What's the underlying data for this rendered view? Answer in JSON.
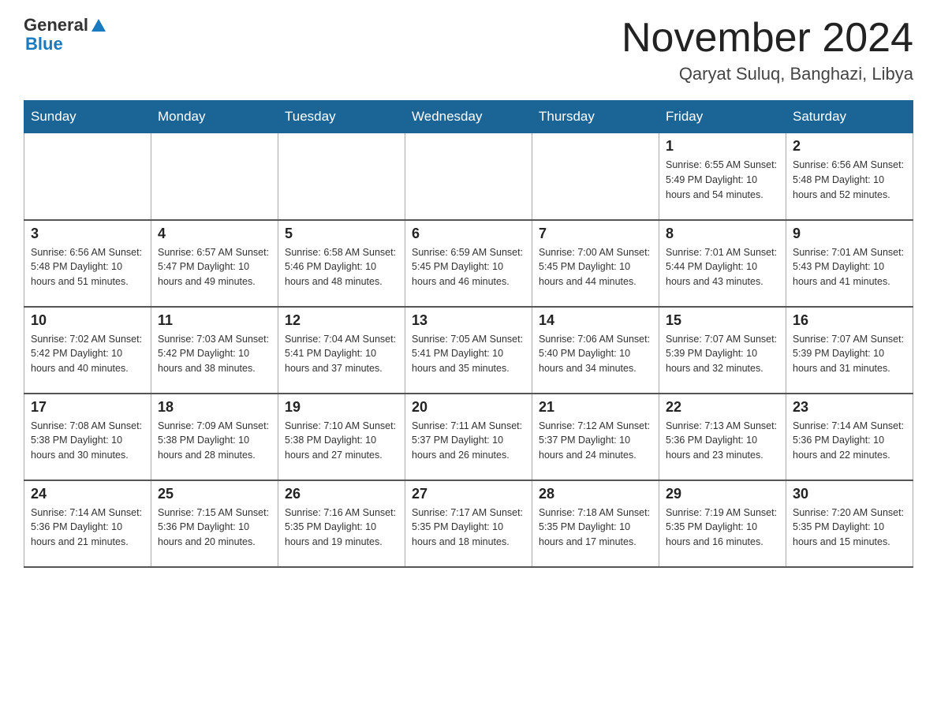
{
  "header": {
    "logo_general": "General",
    "logo_blue": "Blue",
    "month_title": "November 2024",
    "location": "Qaryat Suluq, Banghazi, Libya"
  },
  "days_of_week": [
    "Sunday",
    "Monday",
    "Tuesday",
    "Wednesday",
    "Thursday",
    "Friday",
    "Saturday"
  ],
  "weeks": [
    [
      {
        "day": "",
        "info": ""
      },
      {
        "day": "",
        "info": ""
      },
      {
        "day": "",
        "info": ""
      },
      {
        "day": "",
        "info": ""
      },
      {
        "day": "",
        "info": ""
      },
      {
        "day": "1",
        "info": "Sunrise: 6:55 AM\nSunset: 5:49 PM\nDaylight: 10 hours and 54 minutes."
      },
      {
        "day": "2",
        "info": "Sunrise: 6:56 AM\nSunset: 5:48 PM\nDaylight: 10 hours and 52 minutes."
      }
    ],
    [
      {
        "day": "3",
        "info": "Sunrise: 6:56 AM\nSunset: 5:48 PM\nDaylight: 10 hours and 51 minutes."
      },
      {
        "day": "4",
        "info": "Sunrise: 6:57 AM\nSunset: 5:47 PM\nDaylight: 10 hours and 49 minutes."
      },
      {
        "day": "5",
        "info": "Sunrise: 6:58 AM\nSunset: 5:46 PM\nDaylight: 10 hours and 48 minutes."
      },
      {
        "day": "6",
        "info": "Sunrise: 6:59 AM\nSunset: 5:45 PM\nDaylight: 10 hours and 46 minutes."
      },
      {
        "day": "7",
        "info": "Sunrise: 7:00 AM\nSunset: 5:45 PM\nDaylight: 10 hours and 44 minutes."
      },
      {
        "day": "8",
        "info": "Sunrise: 7:01 AM\nSunset: 5:44 PM\nDaylight: 10 hours and 43 minutes."
      },
      {
        "day": "9",
        "info": "Sunrise: 7:01 AM\nSunset: 5:43 PM\nDaylight: 10 hours and 41 minutes."
      }
    ],
    [
      {
        "day": "10",
        "info": "Sunrise: 7:02 AM\nSunset: 5:42 PM\nDaylight: 10 hours and 40 minutes."
      },
      {
        "day": "11",
        "info": "Sunrise: 7:03 AM\nSunset: 5:42 PM\nDaylight: 10 hours and 38 minutes."
      },
      {
        "day": "12",
        "info": "Sunrise: 7:04 AM\nSunset: 5:41 PM\nDaylight: 10 hours and 37 minutes."
      },
      {
        "day": "13",
        "info": "Sunrise: 7:05 AM\nSunset: 5:41 PM\nDaylight: 10 hours and 35 minutes."
      },
      {
        "day": "14",
        "info": "Sunrise: 7:06 AM\nSunset: 5:40 PM\nDaylight: 10 hours and 34 minutes."
      },
      {
        "day": "15",
        "info": "Sunrise: 7:07 AM\nSunset: 5:39 PM\nDaylight: 10 hours and 32 minutes."
      },
      {
        "day": "16",
        "info": "Sunrise: 7:07 AM\nSunset: 5:39 PM\nDaylight: 10 hours and 31 minutes."
      }
    ],
    [
      {
        "day": "17",
        "info": "Sunrise: 7:08 AM\nSunset: 5:38 PM\nDaylight: 10 hours and 30 minutes."
      },
      {
        "day": "18",
        "info": "Sunrise: 7:09 AM\nSunset: 5:38 PM\nDaylight: 10 hours and 28 minutes."
      },
      {
        "day": "19",
        "info": "Sunrise: 7:10 AM\nSunset: 5:38 PM\nDaylight: 10 hours and 27 minutes."
      },
      {
        "day": "20",
        "info": "Sunrise: 7:11 AM\nSunset: 5:37 PM\nDaylight: 10 hours and 26 minutes."
      },
      {
        "day": "21",
        "info": "Sunrise: 7:12 AM\nSunset: 5:37 PM\nDaylight: 10 hours and 24 minutes."
      },
      {
        "day": "22",
        "info": "Sunrise: 7:13 AM\nSunset: 5:36 PM\nDaylight: 10 hours and 23 minutes."
      },
      {
        "day": "23",
        "info": "Sunrise: 7:14 AM\nSunset: 5:36 PM\nDaylight: 10 hours and 22 minutes."
      }
    ],
    [
      {
        "day": "24",
        "info": "Sunrise: 7:14 AM\nSunset: 5:36 PM\nDaylight: 10 hours and 21 minutes."
      },
      {
        "day": "25",
        "info": "Sunrise: 7:15 AM\nSunset: 5:36 PM\nDaylight: 10 hours and 20 minutes."
      },
      {
        "day": "26",
        "info": "Sunrise: 7:16 AM\nSunset: 5:35 PM\nDaylight: 10 hours and 19 minutes."
      },
      {
        "day": "27",
        "info": "Sunrise: 7:17 AM\nSunset: 5:35 PM\nDaylight: 10 hours and 18 minutes."
      },
      {
        "day": "28",
        "info": "Sunrise: 7:18 AM\nSunset: 5:35 PM\nDaylight: 10 hours and 17 minutes."
      },
      {
        "day": "29",
        "info": "Sunrise: 7:19 AM\nSunset: 5:35 PM\nDaylight: 10 hours and 16 minutes."
      },
      {
        "day": "30",
        "info": "Sunrise: 7:20 AM\nSunset: 5:35 PM\nDaylight: 10 hours and 15 minutes."
      }
    ]
  ]
}
